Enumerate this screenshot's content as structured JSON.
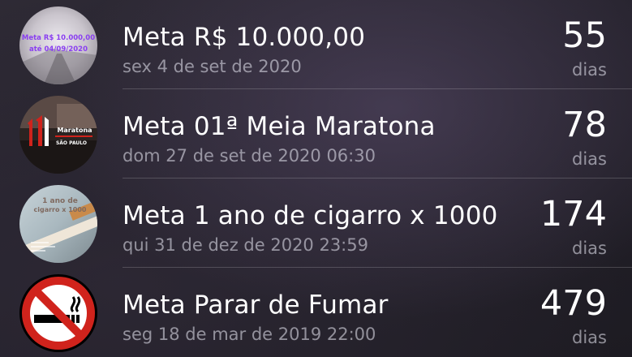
{
  "goals": [
    {
      "title": "Meta R$ 10.000,00",
      "date": "sex 4 de set de 2020",
      "count": "55",
      "unit": "dias",
      "thumb_icon": "money-goal-image",
      "thumb_text_line1": "Meta R$ 10.000,00",
      "thumb_text_line2": "até 04/09/2020"
    },
    {
      "title": "Meta 01ª Meia Maratona",
      "date": "dom 27 de set de 2020 06:30",
      "count": "78",
      "unit": "dias",
      "thumb_icon": "half-marathon-image",
      "thumb_text_line1": "Maratona",
      "thumb_text_line2": "SÃO PAULO"
    },
    {
      "title": "Meta 1 ano de cigarro x 1000",
      "date": "qui 31 de dez de 2020 23:59",
      "count": "174",
      "unit": "dias",
      "thumb_icon": "cigarette-goal-image",
      "thumb_text_line1": "1 ano de",
      "thumb_text_line2": "cigarro x 1000"
    },
    {
      "title": "Meta Parar de Fumar",
      "date": "seg 18 de mar de 2019 22:00",
      "count": "479",
      "unit": "dias",
      "thumb_icon": "no-smoking-icon"
    }
  ],
  "colors": {
    "accent_red": "#d0231c",
    "purple_text": "#8a3ff0",
    "secondary_text": "rgba(235,235,245,0.55)"
  }
}
